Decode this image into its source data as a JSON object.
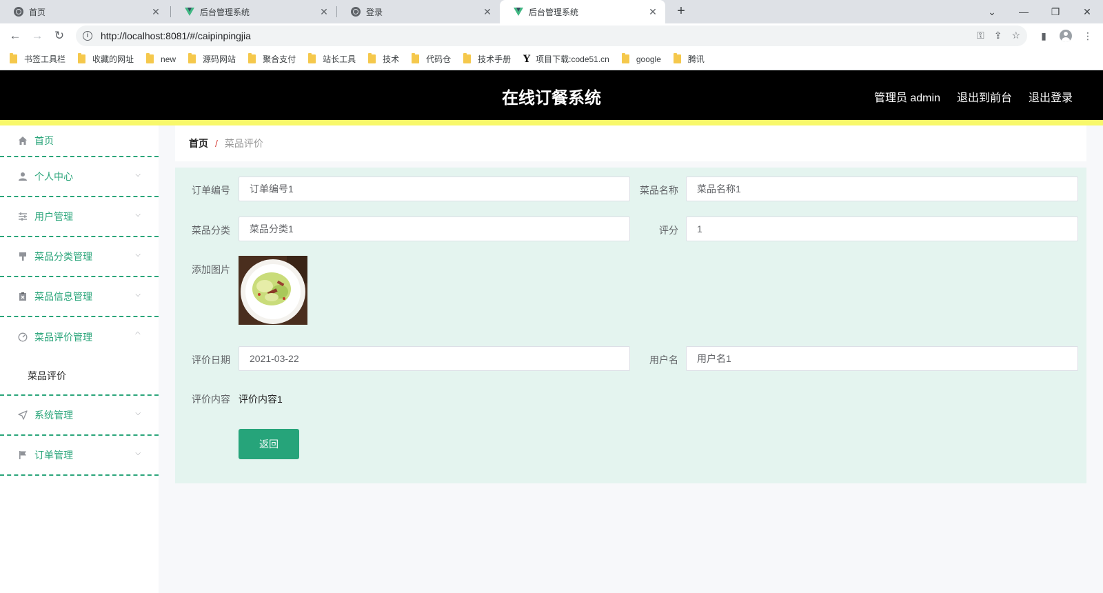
{
  "browser": {
    "tabs": [
      {
        "title": "首页",
        "icon": "globe-icon",
        "active": false
      },
      {
        "title": "后台管理系统",
        "icon": "vue-logo-icon",
        "active": false
      },
      {
        "title": "登录",
        "icon": "globe-icon",
        "active": false
      },
      {
        "title": "后台管理系统",
        "icon": "vue-logo-icon",
        "active": true
      }
    ],
    "url": "http://localhost:8081/#/caipinpingjia",
    "bookmarks": [
      {
        "label": "书签工具栏",
        "icon": "folder-icon"
      },
      {
        "label": "收藏的网址",
        "icon": "folder-icon"
      },
      {
        "label": "new",
        "icon": "folder-icon"
      },
      {
        "label": "源码网站",
        "icon": "folder-icon"
      },
      {
        "label": "聚合支付",
        "icon": "folder-icon"
      },
      {
        "label": "站长工具",
        "icon": "folder-icon"
      },
      {
        "label": "技术",
        "icon": "folder-icon"
      },
      {
        "label": "代码仓",
        "icon": "folder-icon"
      },
      {
        "label": "技术手册",
        "icon": "folder-icon"
      },
      {
        "label": "项目下载:code51.cn",
        "icon": "y-logo-icon"
      },
      {
        "label": "google",
        "icon": "folder-icon"
      },
      {
        "label": "腾讯",
        "icon": "folder-icon"
      }
    ]
  },
  "header": {
    "title": "在线订餐系统",
    "user": "管理员 admin",
    "to_front": "退出到前台",
    "logout": "退出登录"
  },
  "sidebar": {
    "items": [
      {
        "label": "首页",
        "icon": "home-icon"
      },
      {
        "label": "个人中心",
        "icon": "user-icon"
      },
      {
        "label": "用户管理",
        "icon": "sliders-icon"
      },
      {
        "label": "菜品分类管理",
        "icon": "brush-icon"
      },
      {
        "label": "菜品信息管理",
        "icon": "clipboard-icon"
      },
      {
        "label": "菜品评价管理",
        "icon": "gauge-icon"
      },
      {
        "label": "系统管理",
        "icon": "send-icon"
      },
      {
        "label": "订单管理",
        "icon": "flag-icon"
      }
    ],
    "submenu": {
      "label": "菜品评价"
    }
  },
  "breadcrumb": {
    "home": "首页",
    "separator": "/",
    "current": "菜品评价"
  },
  "form": {
    "order_no": {
      "label": "订单编号",
      "value": "订单编号1"
    },
    "dish_name": {
      "label": "菜品名称",
      "value": "菜品名称1"
    },
    "dish_category": {
      "label": "菜品分类",
      "value": "菜品分类1"
    },
    "score": {
      "label": "评分",
      "value": "1"
    },
    "image": {
      "label": "添加图片"
    },
    "review_date": {
      "label": "评价日期",
      "value": "2021-03-22"
    },
    "username": {
      "label": "用户名",
      "value": "用户名1"
    },
    "review_content": {
      "label": "评价内容",
      "value": "评价内容1"
    },
    "back_button": "返回"
  },
  "colors": {
    "accent": "#26a47a",
    "header_bg": "#000000",
    "strip": "#f8f86a",
    "panel_bg": "#e4f4ef"
  }
}
